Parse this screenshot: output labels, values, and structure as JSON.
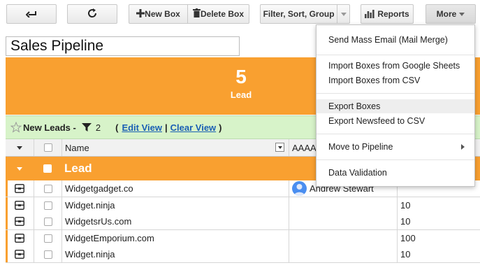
{
  "toolbar": {
    "back_icon": "back-arrow-icon",
    "refresh_icon": "refresh-icon",
    "new_box_label": "New Box",
    "delete_box_label": "Delete Box",
    "filter_label": "Filter, Sort, Group",
    "reports_label": "Reports",
    "more_label": "More"
  },
  "pipeline": {
    "title": "Sales Pipeline"
  },
  "stage": {
    "count": "5",
    "name": "Lead",
    "color": "#f9a030"
  },
  "view": {
    "name": "New Leads -",
    "filter_count": "2",
    "open_paren": "(",
    "edit_view": "Edit View",
    "separator": "|",
    "clear_view": "Clear View",
    "close_paren": ")"
  },
  "table": {
    "columns": {
      "name": "Name",
      "col3": "AAAA"
    },
    "group_label": "Lead",
    "rows": [
      {
        "name": "Widgetgadget.co",
        "assignee": "Andrew Stewart",
        "value": ""
      },
      {
        "name": "Widget.ninja",
        "assignee": "",
        "value": "10"
      },
      {
        "name": "WidgetsrUs.com",
        "assignee": "",
        "value": "10"
      },
      {
        "name": "WidgetEmporium.com",
        "assignee": "",
        "value": "100"
      },
      {
        "name": "Widget.ninja",
        "assignee": "",
        "value": "10"
      }
    ]
  },
  "menu": {
    "items": [
      "Send Mass Email (Mail Merge)",
      "Import Boxes from Google Sheets",
      "Import Boxes from CSV",
      "Export Boxes",
      "Export Newsfeed to CSV",
      "Move to Pipeline",
      "Data Validation"
    ],
    "highlighted": "Export Boxes"
  }
}
